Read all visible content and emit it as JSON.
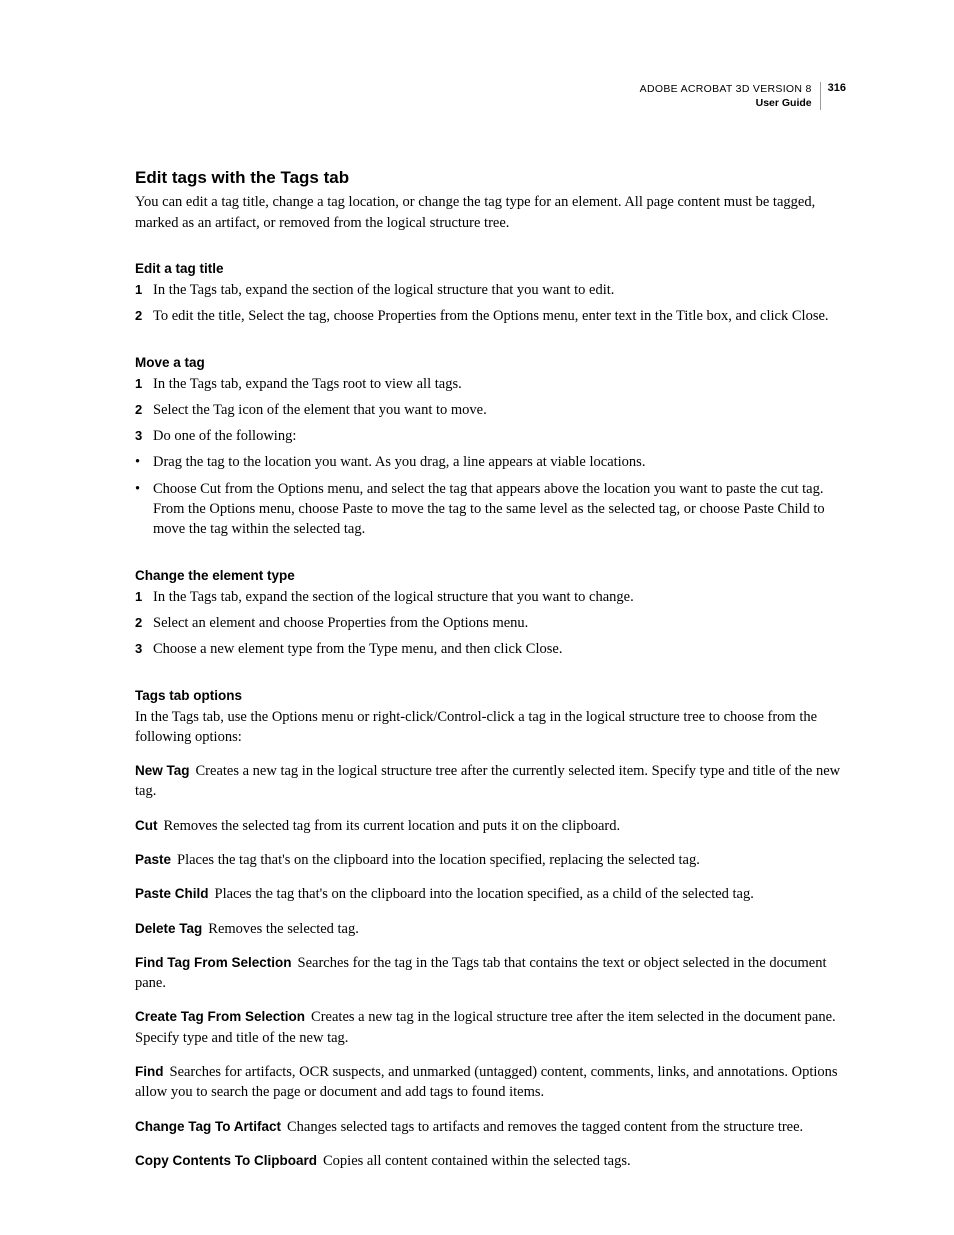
{
  "header": {
    "product": "ADOBE ACROBAT 3D VERSION 8",
    "guide": "User Guide",
    "page": "316"
  },
  "h1": "Edit tags with the Tags tab",
  "intro": "You can edit a tag title, change a tag location, or change the tag type for an element. All page content must be tagged, marked as an artifact, or removed from the logical structure tree.",
  "s1": {
    "title": "Edit a tag title",
    "items": [
      "In the Tags tab, expand the section of the logical structure that you want to edit.",
      "To edit the title, Select the tag, choose Properties from the Options menu, enter text in the Title box, and click Close."
    ]
  },
  "s2": {
    "title": "Move a tag",
    "items": [
      "In the Tags tab, expand the Tags root to view all tags.",
      "Select the Tag icon of the element that you want to move.",
      "Do one of the following:"
    ],
    "bullets": [
      "Drag the tag to the location you want. As you drag, a line appears at viable locations.",
      "Choose Cut from the Options menu, and select the tag that appears above the location you want to paste the cut tag. From the Options menu, choose Paste to move the tag to the same level as the selected tag, or choose Paste Child to move the tag within the selected tag."
    ]
  },
  "s3": {
    "title": "Change the element type",
    "items": [
      "In the Tags tab, expand the section of the logical structure that you want to change.",
      "Select an element and choose Properties from the Options menu.",
      "Choose a new element type from the Type menu, and then click Close."
    ]
  },
  "s4": {
    "title": "Tags tab options",
    "intro": "In the Tags tab, use the Options menu or right-click/Control-click a tag in the logical structure tree to choose from the following options:",
    "defs": [
      {
        "term": "New Tag",
        "desc": "Creates a new tag in the logical structure tree after the currently selected item. Specify type and title of the new tag."
      },
      {
        "term": "Cut",
        "desc": "Removes the selected tag from its current location and puts it on the clipboard."
      },
      {
        "term": "Paste",
        "desc": "Places the tag that's on the clipboard into the location specified, replacing the selected tag."
      },
      {
        "term": "Paste Child",
        "desc": "Places the tag that's on the clipboard into the location specified, as a child of the selected tag."
      },
      {
        "term": "Delete Tag",
        "desc": "Removes the selected tag."
      },
      {
        "term": "Find Tag From Selection",
        "desc": "Searches for the tag in the Tags tab that contains the text or object selected in the document pane."
      },
      {
        "term": "Create Tag From Selection",
        "desc": "Creates a new tag in the logical structure tree after the item selected in the document pane. Specify type and title of the new tag."
      },
      {
        "term": "Find",
        "desc": "Searches for artifacts, OCR suspects, and unmarked (untagged) content, comments, links, and annotations. Options allow you to search the page or document and add tags to found items."
      },
      {
        "term": "Change Tag To Artifact",
        "desc": "Changes selected tags to artifacts and removes the tagged content from the structure tree."
      },
      {
        "term": "Copy Contents To Clipboard",
        "desc": "Copies all content contained within the selected tags."
      }
    ]
  }
}
